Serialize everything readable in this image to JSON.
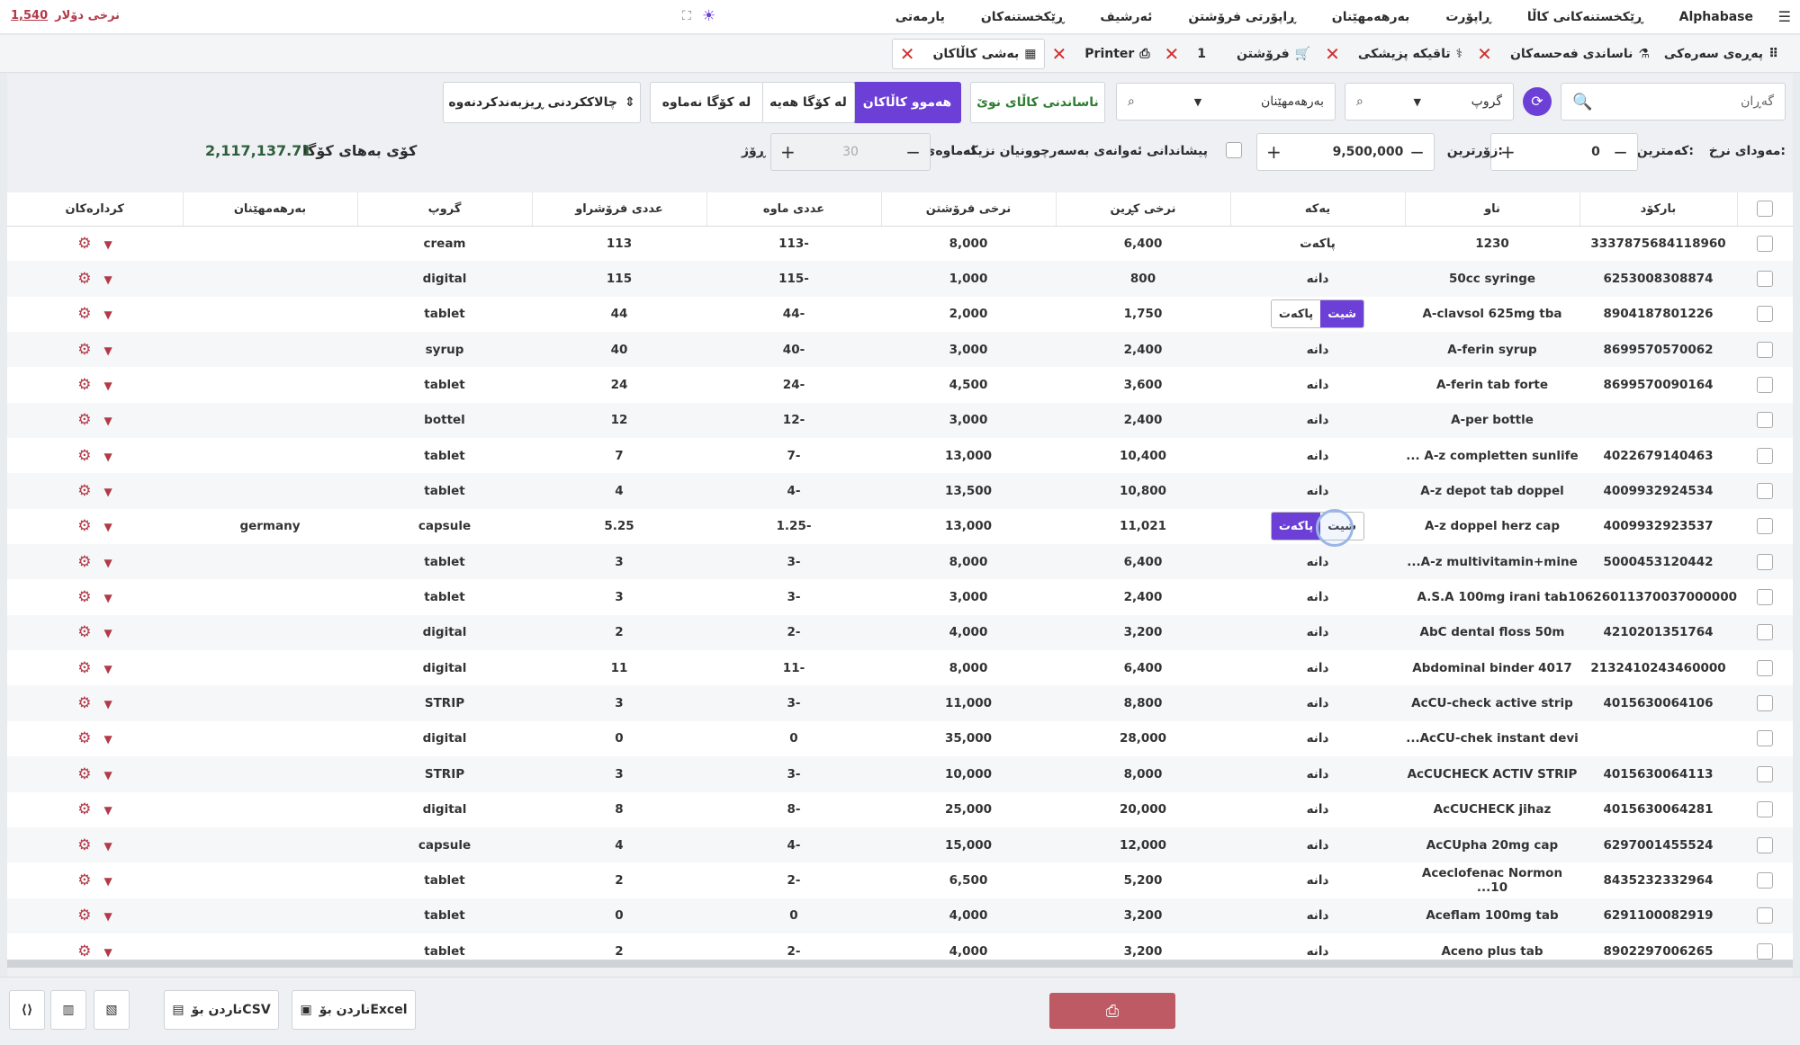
{
  "app": {
    "brand": "Alphabase",
    "menu_icon": "hamburger-icon",
    "nav": [
      "ڕێکخستنەکانی کاڵا",
      "ڕاپۆرت",
      "بەرهەمهێنان",
      "ڕاپۆرتی فرۆشتن",
      "ئەرشیف",
      "ڕێکخستنەکان",
      "یارمەتی"
    ],
    "rate_label": "نرخی دۆلار",
    "rate_value": "1,540"
  },
  "tabs": [
    {
      "label": "پەڕەی سەرەکی",
      "icon": "grid-icon"
    },
    {
      "label": "ناساندی فەحسەکان",
      "icon": "flask-icon"
    },
    {
      "label": "تاقیکە پزیشکی",
      "icon": "stethoscope-icon"
    },
    {
      "label": "فرۆشتن",
      "icon": "cart-icon",
      "count": "1"
    },
    {
      "label": "Printer",
      "icon": "printer-icon"
    },
    {
      "label": "بەشی کاڵاکان",
      "icon": "boxes-icon",
      "active": true
    }
  ],
  "toolbar": {
    "search_placeholder": "گەڕان",
    "group_label": "گروپ",
    "maker_label": "بەرهەمهێنان",
    "new_item": "ناساندنی کاڵای نوێ",
    "all_items": "هەموو کاڵاکان",
    "in_stock": "لە کۆگا هەیە",
    "out_stock": "لە کۆگا نەماوە",
    "print_sort": "چالاککردنی ڕیزبەندکردنەوە"
  },
  "filters": {
    "price_range_label": "مەودای نرخ:",
    "min_label": "کەمترین:",
    "min_value": "0",
    "max_label": "زۆرترین:",
    "max_value": "9,500,000",
    "expiry_label": "پیشاندانی ئەوانەی بەسەرچوونیان نزیکە",
    "remaining_label": "لەماوەی",
    "days_value": "30",
    "days_label": "ڕۆژ",
    "total_label": "کۆی بەهای کۆگا",
    "total_value": "2,117,137.71"
  },
  "columns": [
    "بارکۆد",
    "ناو",
    "یەکە",
    "نرخی کڕین",
    "نرخی فرۆشتن",
    "عددی ماوە",
    "عددی فرۆشراو",
    "گروپ",
    "بەرهەمهێنان",
    "کردارەکان"
  ],
  "rows": [
    {
      "barcode": "3337875684118960",
      "name": "1230",
      "unit": "پاکەت",
      "buy": "6,400",
      "sell": "8,000",
      "remain": "-113",
      "sold": "113",
      "group": "cream",
      "maker": ""
    },
    {
      "barcode": "6253008308874",
      "name": "50cc syringe",
      "unit": "دانە",
      "buy": "800",
      "sell": "1,000",
      "remain": "-115",
      "sold": "115",
      "group": "digital",
      "maker": ""
    },
    {
      "barcode": "8904187801226",
      "name": "A-clavsol 625mg tba",
      "unit": "pill1",
      "buy": "1,750",
      "sell": "2,000",
      "remain": "-44",
      "sold": "44",
      "group": "tablet",
      "maker": ""
    },
    {
      "barcode": "8699570570062",
      "name": "A-ferin syrup",
      "unit": "دانە",
      "buy": "2,400",
      "sell": "3,000",
      "remain": "-40",
      "sold": "40",
      "group": "syrup",
      "maker": ""
    },
    {
      "barcode": "8699570090164",
      "name": "A-ferin tab forte",
      "unit": "دانە",
      "buy": "3,600",
      "sell": "4,500",
      "remain": "-24",
      "sold": "24",
      "group": "tablet",
      "maker": ""
    },
    {
      "barcode": "",
      "name": "A-per bottle",
      "unit": "دانە",
      "buy": "2,400",
      "sell": "3,000",
      "remain": "-12",
      "sold": "12",
      "group": "bottel",
      "maker": ""
    },
    {
      "barcode": "4022679140463",
      "name": "A-z completten sunlife ...",
      "unit": "دانە",
      "buy": "10,400",
      "sell": "13,000",
      "remain": "-7",
      "sold": "7",
      "group": "tablet",
      "maker": ""
    },
    {
      "barcode": "4009932924534",
      "name": "A-z depot tab doppel",
      "unit": "دانە",
      "buy": "10,800",
      "sell": "13,500",
      "remain": "-4",
      "sold": "4",
      "group": "tablet",
      "maker": ""
    },
    {
      "barcode": "4009932923537",
      "name": "A-z doppel herz cap",
      "unit": "pill2",
      "buy": "11,021",
      "sell": "13,000",
      "remain": "-1.25",
      "sold": "5.25",
      "group": "capsule",
      "maker": "germany"
    },
    {
      "barcode": "5000453120442",
      "name": "A-z multivitamin+mine...",
      "unit": "دانە",
      "buy": "6,400",
      "sell": "8,000",
      "remain": "-3",
      "sold": "3",
      "group": "tablet",
      "maker": ""
    },
    {
      "barcode": "10626011370037000000...",
      "name": "A.S.A 100mg irani tab",
      "unit": "دانە",
      "buy": "2,400",
      "sell": "3,000",
      "remain": "-3",
      "sold": "3",
      "group": "tablet",
      "maker": ""
    },
    {
      "barcode": "4210201351764",
      "name": "AbC dental floss 50m",
      "unit": "دانە",
      "buy": "3,200",
      "sell": "4,000",
      "remain": "-2",
      "sold": "2",
      "group": "digital",
      "maker": ""
    },
    {
      "barcode": "2132410243460000",
      "name": "Abdominal binder 4017",
      "unit": "دانە",
      "buy": "6,400",
      "sell": "8,000",
      "remain": "-11",
      "sold": "11",
      "group": "digital",
      "maker": ""
    },
    {
      "barcode": "4015630064106",
      "name": "AcCU-check active strip",
      "unit": "دانە",
      "buy": "8,800",
      "sell": "11,000",
      "remain": "-3",
      "sold": "3",
      "group": "STRIP",
      "maker": ""
    },
    {
      "barcode": "",
      "name": "AcCU-chek instant devi...",
      "unit": "دانە",
      "buy": "28,000",
      "sell": "35,000",
      "remain": "0",
      "sold": "0",
      "group": "digital",
      "maker": ""
    },
    {
      "barcode": "4015630064113",
      "name": "AcCUCHECK ACTIV STRIP",
      "unit": "دانە",
      "buy": "8,000",
      "sell": "10,000",
      "remain": "-3",
      "sold": "3",
      "group": "STRIP",
      "maker": ""
    },
    {
      "barcode": "4015630064281",
      "name": "AcCUCHECK jihaz",
      "unit": "دانە",
      "buy": "20,000",
      "sell": "25,000",
      "remain": "-8",
      "sold": "8",
      "group": "digital",
      "maker": ""
    },
    {
      "barcode": "6297001455524",
      "name": "AcCUpha 20mg cap",
      "unit": "دانە",
      "buy": "12,000",
      "sell": "15,000",
      "remain": "-4",
      "sold": "4",
      "group": "capsule",
      "maker": ""
    },
    {
      "barcode": "8435232332964",
      "name": "Aceclofenac Normon 10...",
      "unit": "دانە",
      "buy": "5,200",
      "sell": "6,500",
      "remain": "-2",
      "sold": "2",
      "group": "tablet",
      "maker": ""
    },
    {
      "barcode": "6291100082919",
      "name": "Aceflam 100mg tab",
      "unit": "دانە",
      "buy": "3,200",
      "sell": "4,000",
      "remain": "0",
      "sold": "0",
      "group": "tablet",
      "maker": ""
    },
    {
      "barcode": "8902297006265",
      "name": "Aceno plus tab",
      "unit": "دانە",
      "buy": "3,200",
      "sell": "4,000",
      "remain": "-2",
      "sold": "2",
      "group": "tablet",
      "maker": ""
    }
  ],
  "pill": {
    "sheet": "شیت",
    "packet": "پاکەت"
  },
  "footer": {
    "excel": "ناردن بۆExcel",
    "csv": "ناردن بۆCSV"
  }
}
